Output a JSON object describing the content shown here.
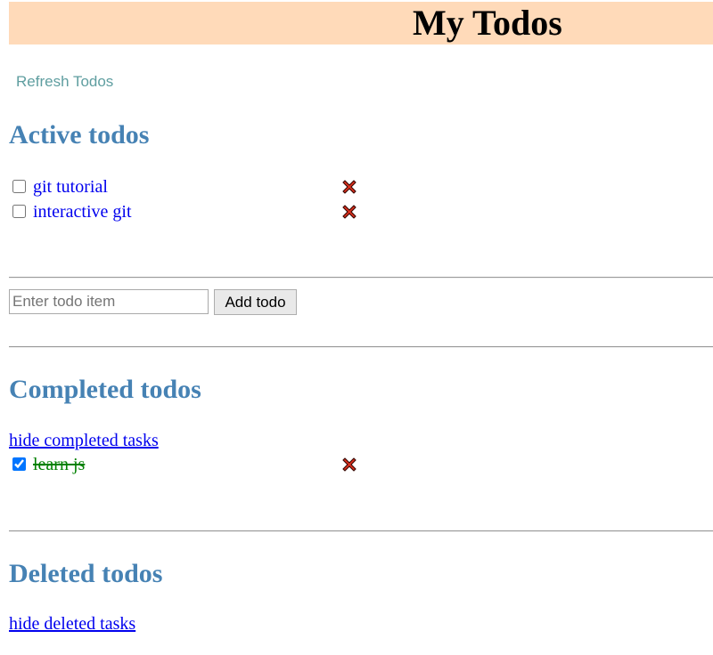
{
  "header": {
    "title": "My Todos",
    "background_color": "#ffdab9"
  },
  "toolbar": {
    "refresh_label": "Refresh Todos"
  },
  "active": {
    "heading": "Active todos",
    "items": [
      {
        "text": "git tutorial",
        "checked": false,
        "delete_icon": "close-icon"
      },
      {
        "text": "interactive git",
        "checked": false,
        "delete_icon": "close-icon"
      }
    ]
  },
  "add_form": {
    "placeholder": "Enter todo item",
    "value": "",
    "button_label": "Add todo"
  },
  "completed": {
    "heading": "Completed todos",
    "toggle_label": "hide completed tasks",
    "items": [
      {
        "text": "learn js",
        "checked": true,
        "delete_icon": "close-icon"
      }
    ]
  },
  "deleted": {
    "heading": "Deleted todos",
    "toggle_label": "hide deleted tasks"
  },
  "colors": {
    "heading": "#4682b4",
    "refresh_link": "#5f9ea0",
    "link": "#0000ee",
    "completed_text": "#008000",
    "delete_icon_fill": "#e0301e"
  }
}
